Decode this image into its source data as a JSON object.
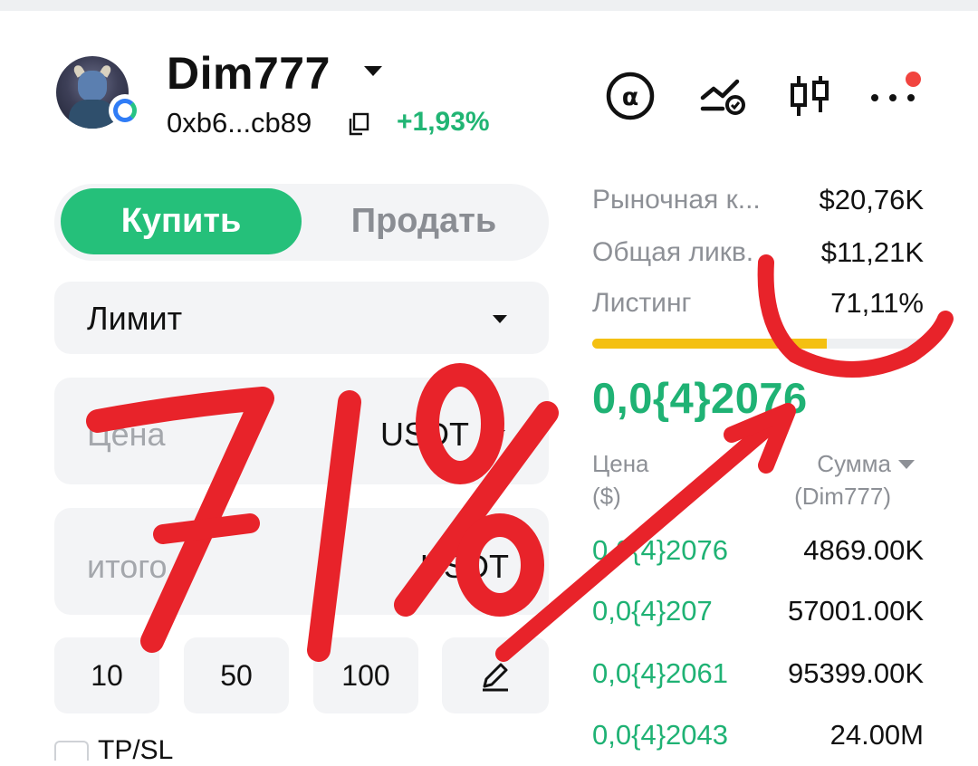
{
  "header": {
    "token_name": "Dim777",
    "address": "0xb6...cb89",
    "change": "+1,93%",
    "icons": [
      "alpha-icon",
      "price-alert-icon",
      "candlestick-icon",
      "more-icon"
    ],
    "notification_color": "#f1443f"
  },
  "trade": {
    "buy_label": "Купить",
    "sell_label": "Продать",
    "order_type": "Лимит",
    "price_placeholder": "Цена",
    "price_currency": "USDT",
    "total_placeholder": "итого",
    "total_currency": "USDT",
    "quick_amounts": [
      "10",
      "50",
      "100"
    ],
    "tpsl_label": "TP/SL",
    "accent_color": "#25c07a"
  },
  "stats": {
    "market_cap_label": "Рыночная к...",
    "market_cap_value": "$20,76K",
    "liquidity_label": "Общая ликв.",
    "liquidity_value": "$11,21K",
    "listing_label": "Листинг",
    "listing_value": "71,11%",
    "listing_progress": 0.7111
  },
  "price": {
    "current": "0,0{4}2076"
  },
  "orderbook": {
    "price_header_1": "Цена",
    "price_header_2": "($)",
    "amount_header_1": "Сумма",
    "amount_header_2": "(Dim777)",
    "rows": [
      {
        "price": "0,0{4}2076",
        "amount": "4869.00K"
      },
      {
        "price": "0,0{4}207",
        "amount": "57001.00K"
      },
      {
        "price": "0,0{4}2061",
        "amount": "95399.00K"
      },
      {
        "price": "0,0{4}2043",
        "amount": "24.00M"
      }
    ]
  },
  "annotation": {
    "text": "71%",
    "color": "#e8232a"
  }
}
